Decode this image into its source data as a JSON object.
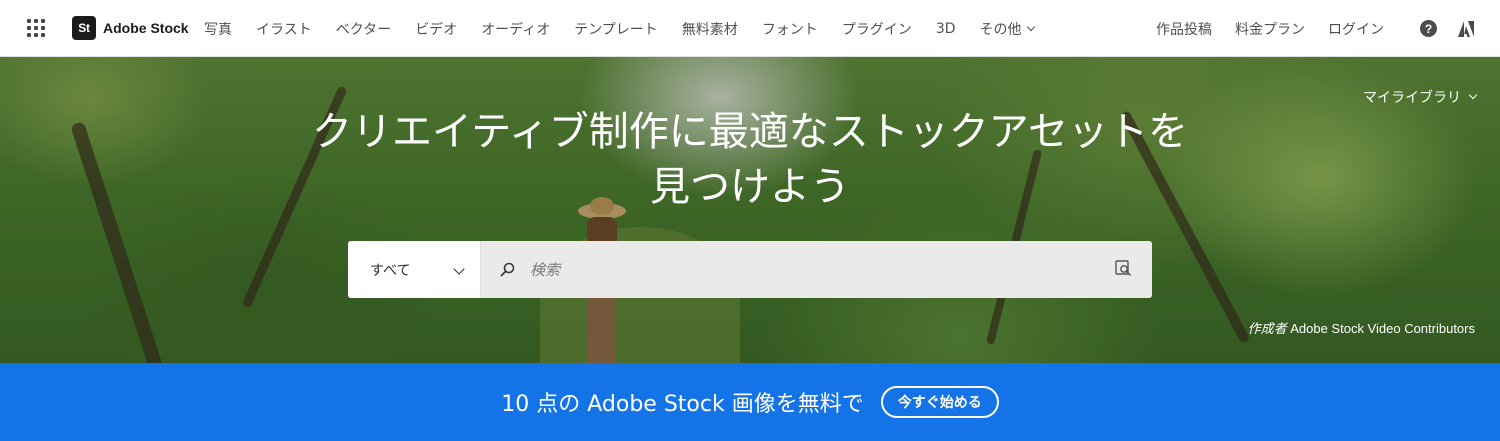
{
  "brand": {
    "logo_text": "St",
    "name": "Adobe Stock"
  },
  "nav": {
    "items": [
      {
        "label": "写真"
      },
      {
        "label": "イラスト"
      },
      {
        "label": "ベクター"
      },
      {
        "label": "ビデオ"
      },
      {
        "label": "オーディオ"
      },
      {
        "label": "テンプレート"
      },
      {
        "label": "無料素材"
      },
      {
        "label": "フォント"
      },
      {
        "label": "プラグイン"
      },
      {
        "label": "3D"
      }
    ],
    "more_label": "その他",
    "right": {
      "contribute_label": "作品投稿",
      "pricing_label": "料金プラン",
      "login_label": "ログイン",
      "help_glyph": "?"
    }
  },
  "hero": {
    "my_library_label": "マイライブラリ",
    "title": "クリエイティブ制作に最適なストックアセットを見つけよう",
    "search": {
      "type_label": "すべて",
      "placeholder": "検索"
    },
    "credit": {
      "by_label": "作成者",
      "author": "Adobe Stock Video Contributors"
    }
  },
  "promo": {
    "text": "10 点の Adobe Stock 画像を無料で",
    "button_label": "今すぐ始める",
    "background_color": "#1473e6"
  },
  "icons": {
    "app_switcher": "grid-icon",
    "help": "help-icon",
    "adobe": "adobe-logo-icon",
    "search": "search-icon",
    "visual_search": "visual-search-icon"
  }
}
